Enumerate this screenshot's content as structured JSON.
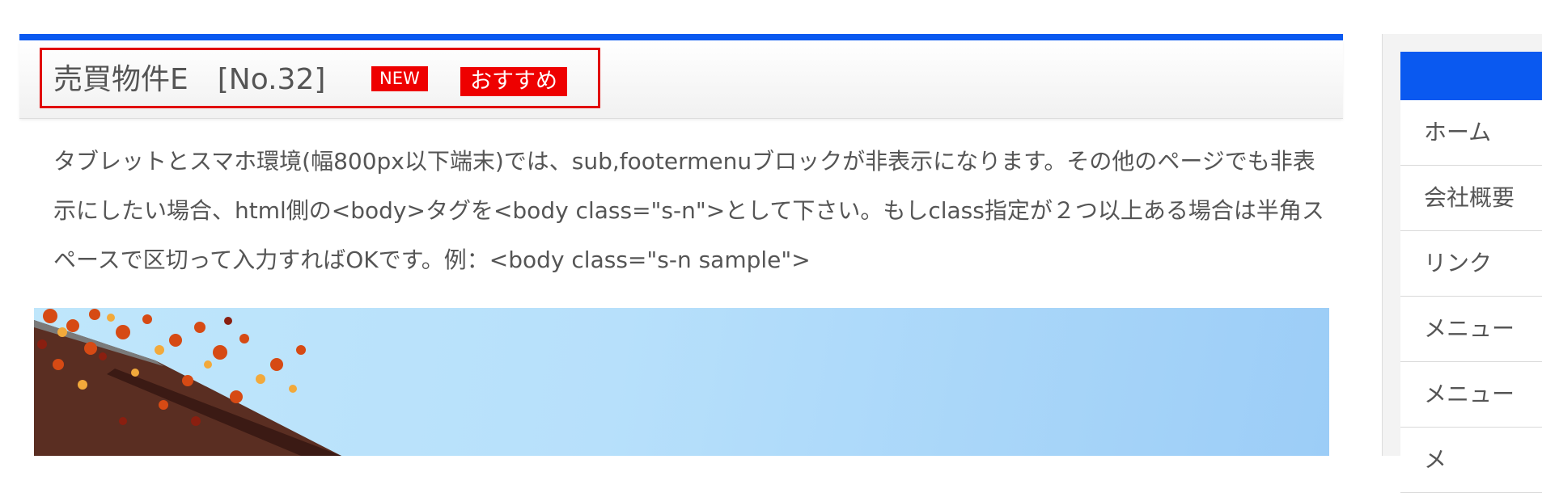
{
  "article": {
    "title": "売買物件E　[No.32]",
    "badge_new": "NEW",
    "badge_recommend": "おすすめ",
    "body_text": "タブレットとスマホ環境(幅800px以下端末)では、sub,footermenuブロックが非表示になります。その他のページでも非表示にしたい場合、html側の<body>タグを<body class=\"s-n\">として下さい。もしclass指定が２つ以上ある場合は半角スペースで区切って入力すればOKです。例：<body class=\"s-n sample\">"
  },
  "sidebar": {
    "items": [
      {
        "label": "ホーム"
      },
      {
        "label": "会社概要"
      },
      {
        "label": "リンク"
      },
      {
        "label": "メニュー"
      },
      {
        "label": "メニュー"
      },
      {
        "label": "メ"
      }
    ]
  },
  "colors": {
    "accent_blue": "#0a59f0",
    "badge_red": "#ee0000",
    "highlight_border": "#e10000"
  }
}
